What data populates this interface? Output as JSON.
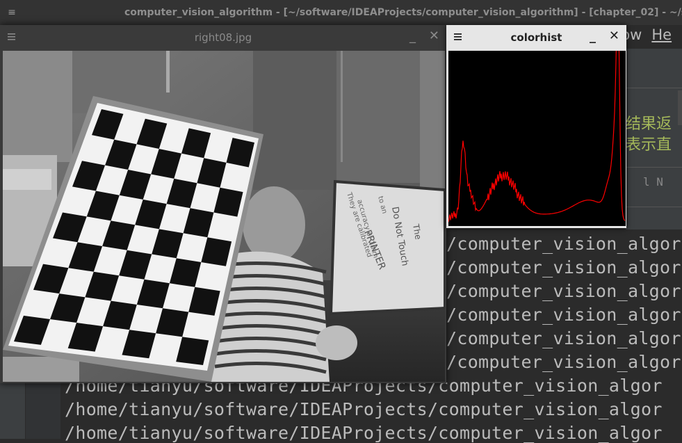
{
  "ide": {
    "window_title": "computer_vision_algorithm - [~/software/IDEAProjects/computer_vision_algorithm] - [chapter_02] - ~/software/",
    "menu": {
      "window_fragment": "dow",
      "help_fragment": "He"
    },
    "editor_fragments": {
      "cn_line1": "结果返",
      "cn_line2": "表示直",
      "code": "l  N"
    },
    "console": {
      "lines": [
        "/computer_vision_algor",
        "/computer_vision_algor",
        "/computer_vision_algor",
        "/computer_vision_algor",
        "/computer_vision_algor",
        "/computer_vision_algor",
        "/home/tianyu/software/IDEAProjects/computer_vision_algor",
        "/home/tianyu/software/IDEAProjects/computer_vision_algor",
        "/home/tianyu/software/IDEAProjects/computer_vision_algor"
      ]
    }
  },
  "image_window": {
    "title": "right08.jpg",
    "minimize_glyph": "_",
    "close_glyph": "✕",
    "menu_icon": "hamburger-menu-icon",
    "whiteboard_text": [
      "Do Not Touch",
      "The",
      "PRINTER",
      "They are calibrated",
      "to an",
      "accuracy of 1mm"
    ]
  },
  "hist_window": {
    "title": "colorhist",
    "minimize_glyph": "_",
    "close_glyph": "✕",
    "menu_icon": "hamburger-menu-icon",
    "line_color": "#ff0000"
  },
  "colors": {
    "ide_bg": "#2b2b2b",
    "console_text": "#bbbbbb",
    "chinese_text": "#a5b95a",
    "titlebar_dark": "#3a3a3a",
    "titlebar_light": "#e6e6e6"
  }
}
